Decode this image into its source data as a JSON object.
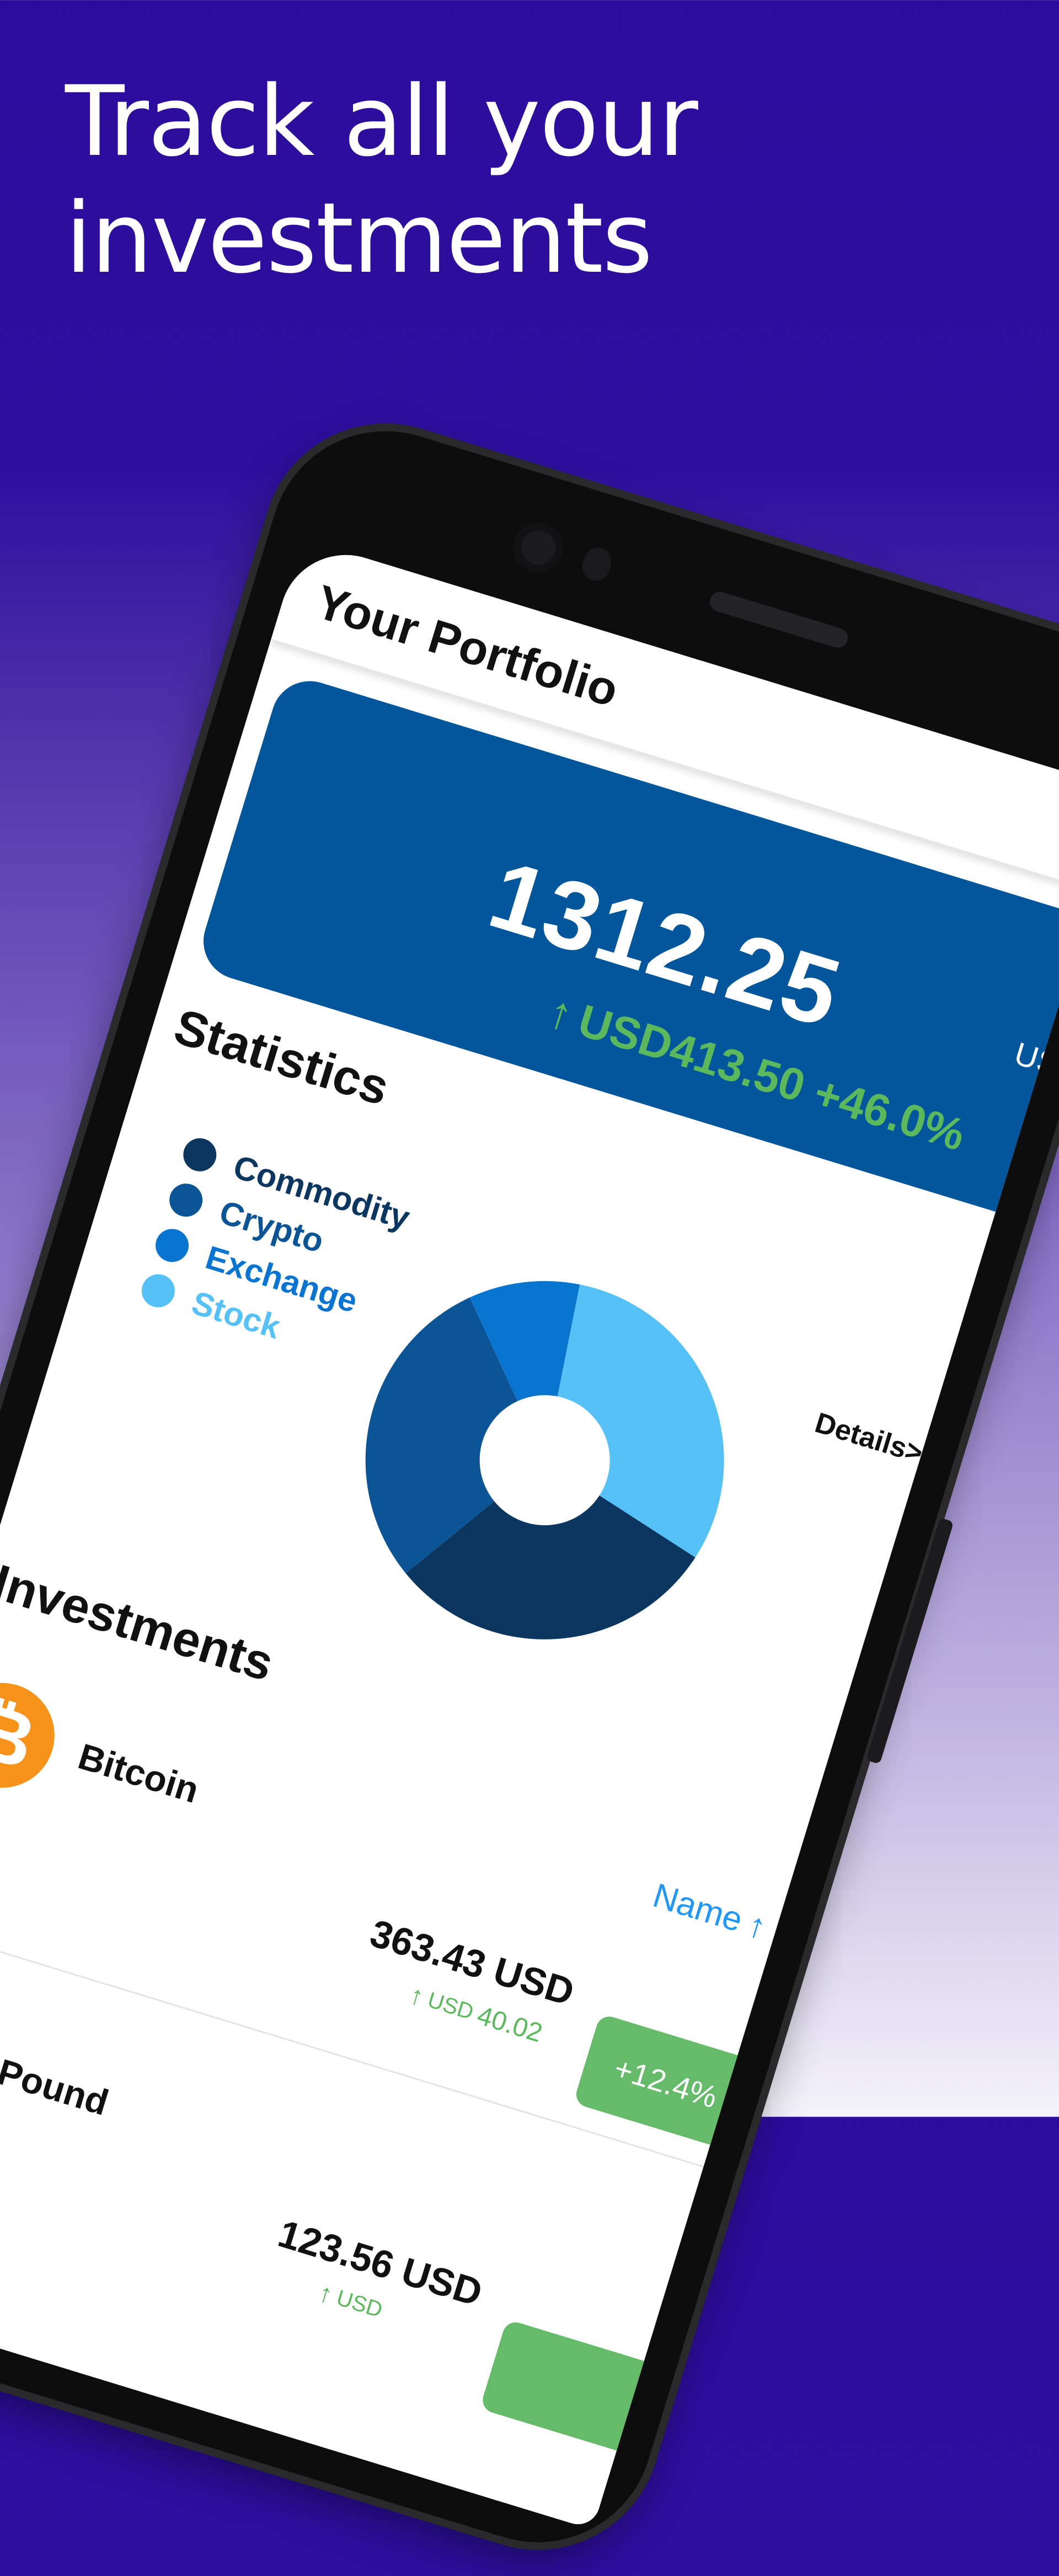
{
  "headline": {
    "line1": "Track all your",
    "line2": "investments"
  },
  "app": {
    "title": "Your Portfolio",
    "portfolio": {
      "total": "1312.25",
      "currency": "US",
      "change_arrow": "↑",
      "change_text": "USD413.50 +46.0%"
    },
    "statistics": {
      "title": "Statistics",
      "details_link": "Details>",
      "legend": [
        {
          "label": "Commodity",
          "color": "#0b365f"
        },
        {
          "label": "Crypto",
          "color": "#0b5596"
        },
        {
          "label": "Exchange",
          "color": "#0a74d1"
        },
        {
          "label": "Stock",
          "color": "#55c1f6"
        }
      ]
    },
    "investments": {
      "title": "Investments",
      "sort_label": "Name",
      "sort_arrow": "↑",
      "items": [
        {
          "name": "Bitcoin",
          "icon": "bitcoin-icon",
          "value": "363.43 USD",
          "change_arrow": "↑",
          "change_currency": "USD",
          "change_amount": "40.02",
          "percent": "+12.4%"
        },
        {
          "name": "British Pound",
          "icon": "pound-icon",
          "value": "123.56 USD",
          "change_arrow": "↑",
          "change_currency": "USD",
          "change_amount": "",
          "percent": ""
        }
      ]
    }
  },
  "chart_data": {
    "type": "pie",
    "style": "donut",
    "categories": [
      "Stock",
      "Commodity",
      "Crypto",
      "Exchange"
    ],
    "values": [
      31,
      30,
      29,
      10
    ],
    "colors": [
      "#55c1f6",
      "#0b365f",
      "#0b5596",
      "#0a74d1"
    ]
  },
  "colors": {
    "card_blue": "#03569b",
    "positive_green": "#5cb85c",
    "badge_green": "#66bb6a",
    "link_blue": "#2196f3",
    "background_top": "#2c0c9c"
  }
}
